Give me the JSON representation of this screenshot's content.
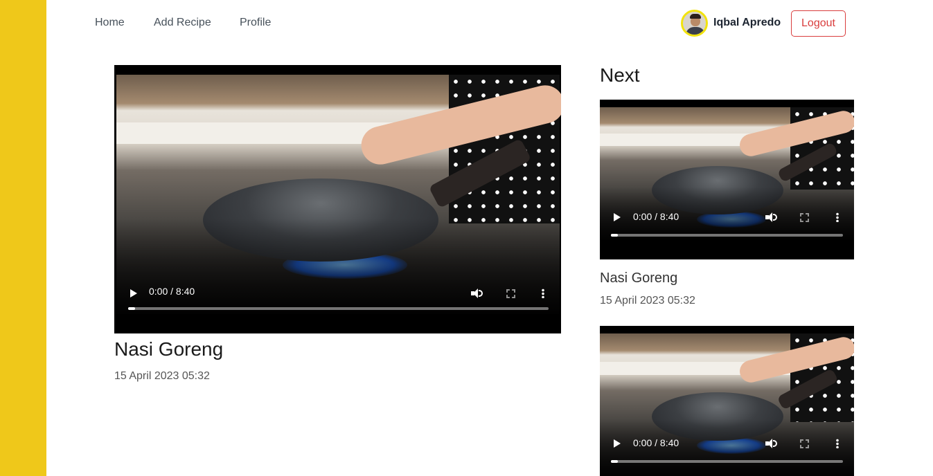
{
  "nav": {
    "links": [
      "Home",
      "Add Recipe",
      "Profile"
    ],
    "user_name": "Iqbal Apredo",
    "logout_label": "Logout"
  },
  "main_video": {
    "time": "0:00 / 8:40",
    "progress": 0,
    "title": "Nasi Goreng",
    "date": "15 April 2023 05:32"
  },
  "next": {
    "heading": "Next",
    "items": [
      {
        "time": "0:00 / 8:40",
        "progress": 0,
        "title": "Nasi Goreng",
        "date": "15 April 2023 05:32"
      },
      {
        "time": "0:00 / 8:40",
        "progress": 0
      }
    ]
  },
  "colors": {
    "sidebar": "#efc81a",
    "logout": "#d93c3c",
    "avatar_ring": "#f2e30e"
  }
}
